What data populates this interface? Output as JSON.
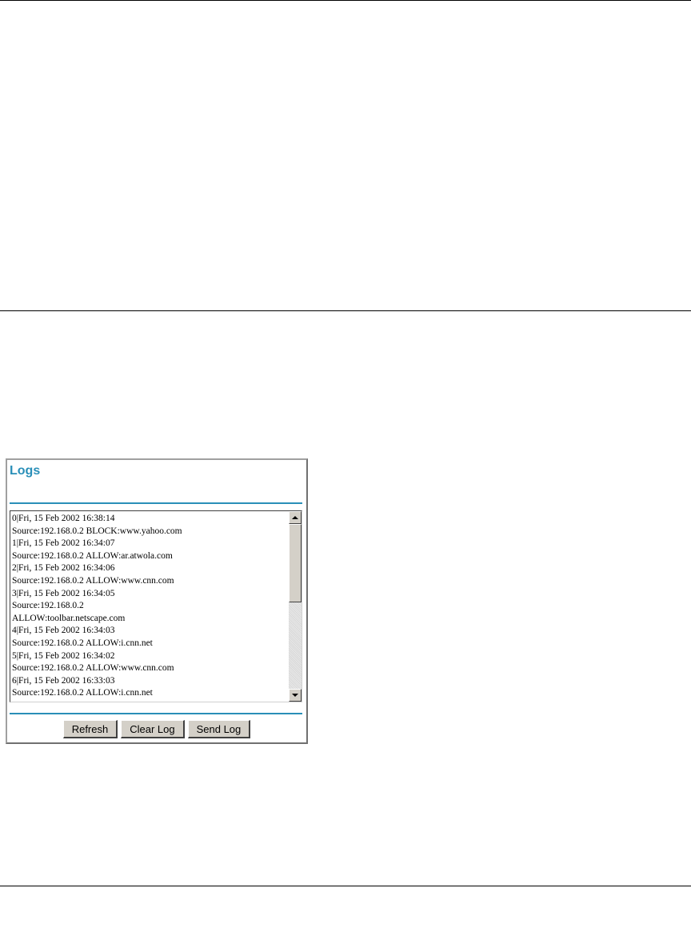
{
  "panel": {
    "title": "Logs",
    "log_text": "0|Fri, 15 Feb 2002 16:38:14\nSource:192.168.0.2 BLOCK:www.yahoo.com\n1|Fri, 15 Feb 2002 16:34:07\nSource:192.168.0.2 ALLOW:ar.atwola.com\n2|Fri, 15 Feb 2002 16:34:06\nSource:192.168.0.2 ALLOW:www.cnn.com\n3|Fri, 15 Feb 2002 16:34:05\nSource:192.168.0.2\nALLOW:toolbar.netscape.com\n4|Fri, 15 Feb 2002 16:34:03\nSource:192.168.0.2 ALLOW:i.cnn.net\n5|Fri, 15 Feb 2002 16:34:02\nSource:192.168.0.2 ALLOW:www.cnn.com\n6|Fri, 15 Feb 2002 16:33:03\nSource:192.168.0.2 ALLOW:i.cnn.net",
    "buttons": {
      "refresh": "Refresh",
      "clear_log": "Clear Log",
      "send_log": "Send Log"
    }
  },
  "colors": {
    "accent": "#2a8fb8",
    "button_face": "#d4d0c8"
  },
  "icons": {
    "scroll_up": "scroll-up-arrow-icon",
    "scroll_down": "scroll-down-arrow-icon"
  }
}
